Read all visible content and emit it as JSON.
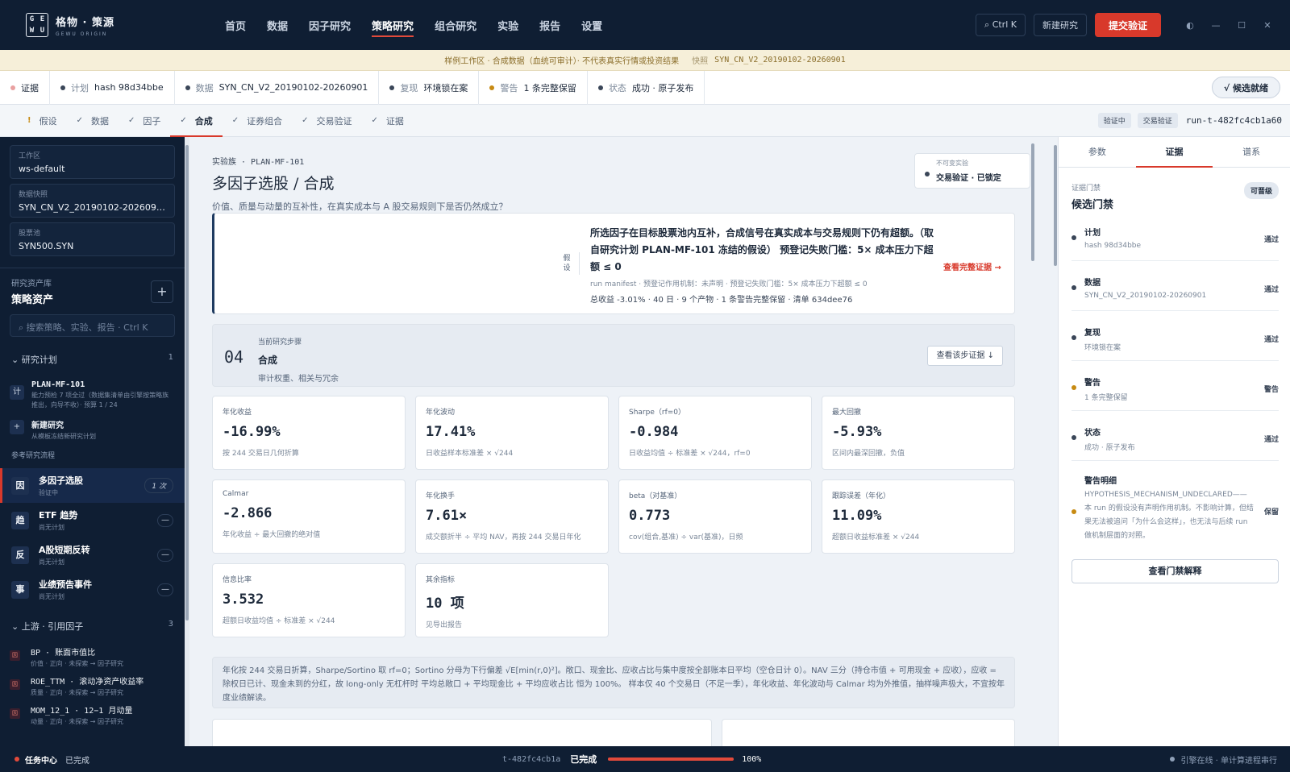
{
  "brand": {
    "logo_letters": [
      "G",
      "E",
      "W",
      "U"
    ],
    "name_cn": "格物 · 策源",
    "name_en": "GEWU ORIGIN"
  },
  "nav": {
    "items": [
      "首页",
      "数据",
      "因子研究",
      "策略研究",
      "组合研究",
      "实验",
      "报告",
      "设置"
    ],
    "active": "策略研究",
    "search_shortcut": "⌕ Ctrl K",
    "new_research": "新建研究",
    "submit": "提交验证",
    "window_icons": [
      "◐",
      "—",
      "☐",
      "✕"
    ]
  },
  "banner": {
    "text": "样例工作区 · 合成数据（血统可审计）· 不代表真实行情或投资结果",
    "snapshot_label": "快照",
    "snapshot_value": "SYN_CN_V2_20190102-20260901"
  },
  "status_strip": {
    "items": [
      {
        "key": "证据",
        "value": "",
        "color": "#e9a0a0"
      },
      {
        "key": "计划",
        "value": "hash 98d34bbe",
        "color": "#3a4658"
      },
      {
        "key": "数据",
        "value": "SYN_CN_V2_20190102-20260901",
        "color": "#3a4658"
      },
      {
        "key": "复现",
        "value": "环境锁在案",
        "color": "#3a4658"
      },
      {
        "key": "警告",
        "value": "1 条完整保留",
        "color": "#c78a12"
      },
      {
        "key": "状态",
        "value": "成功 · 原子发布",
        "color": "#3a4658"
      }
    ],
    "ready_label": "√  候选就绪"
  },
  "steps": {
    "items": [
      {
        "mark": "!",
        "label": "假设"
      },
      {
        "mark": "✓",
        "label": "数据"
      },
      {
        "mark": "✓",
        "label": "因子"
      },
      {
        "mark": "✓",
        "label": "合成"
      },
      {
        "mark": "✓",
        "label": "证券组合"
      },
      {
        "mark": "✓",
        "label": "交易验证"
      },
      {
        "mark": "✓",
        "label": "证据"
      }
    ],
    "active": "合成",
    "pill1": "验证中",
    "pill2": "交易验证",
    "run_id": "run-t-482fc4cb1a60"
  },
  "sidebar": {
    "fields": [
      {
        "k": "工作区",
        "v": "ws-default"
      },
      {
        "k": "数据快照",
        "v": "SYN_CN_V2_20190102-20260901"
      },
      {
        "k": "股票池",
        "v": "SYN500.SYN"
      }
    ],
    "lib_k": "研究资产库",
    "lib_t": "策略资产",
    "plus": "+",
    "search": "⌕  搜索策略、实验、报告 · Ctrl K",
    "sec1": {
      "label": "⌄  研究计划",
      "count": "1"
    },
    "plan": {
      "icon": "计",
      "title": "PLAN-MF-101",
      "desc": "能力预检 7 项全过（数据集清单由引擎按策略族推出，向导不收）· 预算 1 / 24"
    },
    "newres": {
      "icon": "+",
      "title": "新建研究",
      "desc": "从模板冻结新研究计划"
    },
    "flows_label": "参考研究流程",
    "flows": [
      {
        "icon": "因",
        "title": "多因子选股",
        "desc": "验证中",
        "badge": "1 次"
      },
      {
        "icon": "趋",
        "title": "ETF 趋势",
        "desc": "尚无计划",
        "badge": "—"
      },
      {
        "icon": "反",
        "title": "A股短期反转",
        "desc": "尚无计划",
        "badge": "—"
      },
      {
        "icon": "事",
        "title": "业绩预告事件",
        "desc": "尚无计划",
        "badge": "—"
      }
    ],
    "sec2": {
      "label": "⌄  上游 · 引用因子",
      "count": "3"
    },
    "factors": [
      {
        "icon": "因",
        "title": "BP · 账面市值比",
        "desc": "价值 · 正向 · 未探索 → 因子研究"
      },
      {
        "icon": "因",
        "title": "ROE_TTM · 滚动净资产收益率",
        "desc": "质量 · 正向 · 未探索 → 因子研究"
      },
      {
        "icon": "因",
        "title": "MOM_12_1 · 12−1 月动量",
        "desc": "动量 · 正向 · 未探索 → 因子研究"
      }
    ]
  },
  "main": {
    "kicker": "实验族 · PLAN-MF-101",
    "title": "多因子选股 / 合成",
    "question": "价值、质量与动量的互补性，在真实成本与 A 股交易规则下是否仍然成立？",
    "lock": {
      "k": "不可变实验",
      "v": "交易验证 · 已锁定"
    },
    "hyp": {
      "label": "假设",
      "main": "所选因子在目标股票池内互补，合成信号在真实成本与交易规则下仍有超额。（取自研究计划 PLAN-MF-101 冻结的假设）  预登记失败门槛：5× 成本压力下超额 ≤ 0",
      "meta": "run manifest · 预登记作用机制：未声明 · 预登记失败门槛：5× 成本压力下超额 ≤ 0",
      "summary": "总收益 -3.01% · 40 日 · 9 个产物 · 1 条警告完整保留 · 清单 634dee76",
      "link": "查看完整证据 →"
    },
    "step": {
      "num": "04",
      "k": "当前研究步骤",
      "title": "合成",
      "desc": "审计权重、相关与冗余",
      "btn": "查看该步证据 ↓"
    },
    "metrics": [
      {
        "k": "年化收益",
        "v": "-16.99%",
        "d": "按 244 交易日几何折算"
      },
      {
        "k": "年化波动",
        "v": "17.41%",
        "d": "日收益样本标准差 × √244"
      },
      {
        "k": "Sharpe（rf=0）",
        "v": "-0.984",
        "d": "日收益均值 ÷ 标准差 × √244，rf=0"
      },
      {
        "k": "最大回撤",
        "v": "-5.93%",
        "d": "区间内最深回撤，负值"
      },
      {
        "k": "Calmar",
        "v": "-2.866",
        "d": "年化收益 ÷ 最大回撤的绝对值"
      },
      {
        "k": "年化换手",
        "v": "7.61×",
        "d": "成交额折半 ÷ 平均 NAV，再按 244 交易日年化"
      },
      {
        "k": "beta（对基准）",
        "v": "0.773",
        "d": "cov(组合,基准) ÷ var(基准)，日频"
      },
      {
        "k": "跟踪误差（年化）",
        "v": "11.09%",
        "d": "超额日收益标准差 × √244"
      },
      {
        "k": "信息比率",
        "v": "3.532",
        "d": "超额日收益均值 ÷ 标准差 × √244"
      },
      {
        "k": "其余指标",
        "v": "10 项",
        "d": "见导出报告"
      }
    ],
    "note": "年化按 244 交易日折算，Sharpe/Sortino 取 rf=0；Sortino 分母为下行偏差 √E[min(r,0)²]。敞口、现金比、应收占比与集中度按全部账本日平均（空仓日计 0）。NAV 三分（持仓市值 + 可用现金 + 应收），应收 = 除权日已计、现金未到的分红，故 long-only 无杠杆时 平均总敞口 + 平均现金比 + 平均应收占比 恒为 100%。 样本仅 40 个交易日（不足一季），年化收益、年化波动与 Calmar 均为外推值，抽样噪声极大，不宜按年度业绩解读。"
  },
  "rpanel": {
    "tabs": [
      "参数",
      "证据",
      "谱系"
    ],
    "active": "证据",
    "gate_k": "证据门禁",
    "gate_t": "候选门禁",
    "gate_tag": "可晋级",
    "gates": [
      {
        "a": "计划",
        "b": "hash 98d34bbe",
        "s": "通过",
        "color": "#3a4658"
      },
      {
        "a": "数据",
        "b": "SYN_CN_V2_20190102-20260901",
        "s": "通过",
        "color": "#3a4658"
      },
      {
        "a": "复现",
        "b": "环境锁在案",
        "s": "通过",
        "color": "#3a4658"
      },
      {
        "a": "警告",
        "b": "1 条完整保留",
        "s": "警告",
        "color": "#c78a12"
      },
      {
        "a": "状态",
        "b": "成功 · 原子发布",
        "s": "通过",
        "color": "#3a4658"
      }
    ],
    "warn": {
      "a": "警告明细",
      "b": "HYPOTHESIS_MECHANISM_UNDECLARED——本 run 的假设没有声明作用机制。不影响计算，但结果无法被追问「为什么会这样」，也无法与后续 run 做机制层面的对照。",
      "s": "保留",
      "color": "#c78a12"
    },
    "btn": "查看门禁解释"
  },
  "bottom": {
    "left_a": "任务中心",
    "left_b": "已完成",
    "run": "t-482fc4cb1a",
    "status": "已完成",
    "progress": 1.0,
    "pct": "100%",
    "right": "引擎在线 · 单计算进程串行"
  }
}
